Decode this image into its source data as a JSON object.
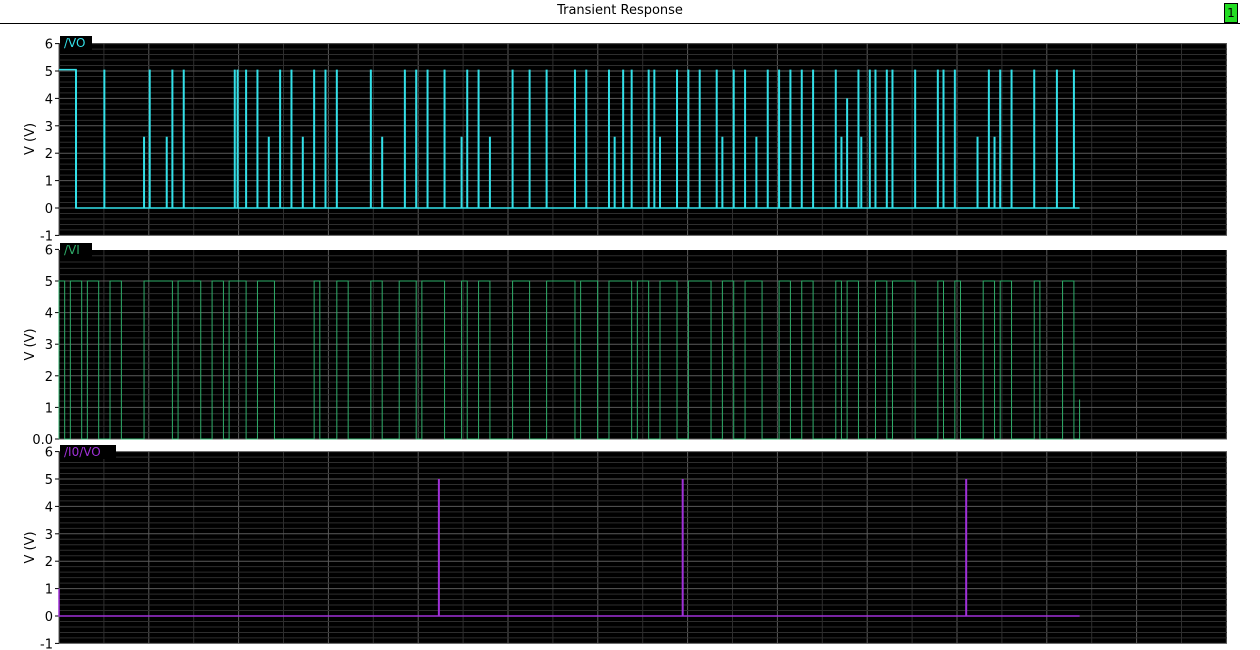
{
  "window": {
    "title": "Transient Response",
    "badge": "1"
  },
  "colors": {
    "background": "#000000",
    "grid_major": "#5a5a5a",
    "grid_minor": "#2e2e2e",
    "vo": "#33e0e8",
    "vi": "#2fae6a",
    "i0_vo": "#a030d8"
  },
  "chart_data": [
    {
      "type": "line",
      "series": [
        {
          "name": "/VO",
          "style": "spikes",
          "baseline": 0,
          "x": [
            0,
            3,
            8,
            15,
            16,
            19,
            20,
            22,
            31,
            31.5,
            33,
            35,
            37,
            39,
            41,
            43,
            45,
            47,
            49,
            55,
            57,
            61,
            63,
            65,
            68,
            71,
            72,
            74,
            76,
            80,
            83,
            86,
            91,
            93,
            97,
            98,
            99.5,
            101,
            104,
            105,
            106,
            109,
            111,
            113,
            116,
            117,
            119,
            121,
            123,
            125,
            127,
            129,
            131,
            133,
            137,
            138,
            139,
            141,
            141.5,
            143,
            144,
            146,
            147,
            151,
            155,
            156,
            158,
            162,
            164,
            165,
            166,
            168,
            172,
            176,
            179
          ],
          "y": [
            5.05,
            5.05,
            5.05,
            2.6,
            5.05,
            2.6,
            5.05,
            5.05,
            5.05,
            5.05,
            5.05,
            5.05,
            2.6,
            5.05,
            5.05,
            2.6,
            5.05,
            5.05,
            5.05,
            5.05,
            2.6,
            5.05,
            5.05,
            5.05,
            5.05,
            2.6,
            5.05,
            5.05,
            2.6,
            5.05,
            5.05,
            5.05,
            5.05,
            5.05,
            5.05,
            2.6,
            5.05,
            5.05,
            5.05,
            5.05,
            2.6,
            5.05,
            5.05,
            5.05,
            5.05,
            2.6,
            5.05,
            5.05,
            2.6,
            5.05,
            5.05,
            5.05,
            5.05,
            5.05,
            5.05,
            2.6,
            4.0,
            5.05,
            2.6,
            5.05,
            5.05,
            5.05,
            5.05,
            5.05,
            5.05,
            5.05,
            5.05,
            2.6,
            5.05,
            2.6,
            5.05,
            5.05,
            5.05,
            5.05,
            5.05
          ],
          "initial_level": 5.05,
          "initial_until": 3,
          "end": 180
        }
      ],
      "ylim": [
        -1,
        6
      ],
      "yticks": [
        -1,
        0,
        1,
        2,
        3,
        4,
        5,
        6
      ],
      "ylabel": "V (V)"
    },
    {
      "type": "line",
      "series": [
        {
          "name": "/VI",
          "style": "pulse",
          "high": 5,
          "low": 0,
          "x": [
            0,
            1,
            2,
            4,
            5,
            7,
            9,
            11,
            15,
            20,
            21,
            25,
            27,
            29,
            30,
            33,
            35,
            38,
            45,
            46,
            49,
            51,
            55,
            57,
            60,
            63,
            64,
            68,
            71,
            72,
            74,
            76,
            80,
            83,
            86,
            91,
            92,
            95,
            97,
            101,
            102,
            104,
            106,
            109,
            111,
            115,
            117,
            119,
            121,
            124,
            127,
            129,
            131,
            133,
            137,
            138,
            139,
            141,
            144,
            146,
            147,
            151,
            155,
            156,
            158,
            159,
            163,
            165,
            166,
            168,
            172,
            173,
            177,
            179
          ],
          "end": 180,
          "tail": 1.25
        }
      ],
      "ylim": [
        0,
        6
      ],
      "yticks": [
        0,
        1,
        2,
        3,
        4,
        5,
        6
      ],
      "ytick_labels": [
        "0.0",
        "1",
        "2",
        "3",
        "4",
        "5",
        "6"
      ],
      "ylabel": "V (V)"
    },
    {
      "type": "line",
      "series": [
        {
          "name": "/I0/VO",
          "style": "spikes",
          "baseline": 0,
          "x": [
            67,
            110,
            160
          ],
          "y": [
            5,
            5,
            5
          ],
          "start_level": 1,
          "end": 180
        }
      ],
      "ylim": [
        -1,
        6
      ],
      "yticks": [
        -1,
        0,
        1,
        2,
        3,
        4,
        5,
        6
      ],
      "ylabel": "V (V)"
    }
  ]
}
